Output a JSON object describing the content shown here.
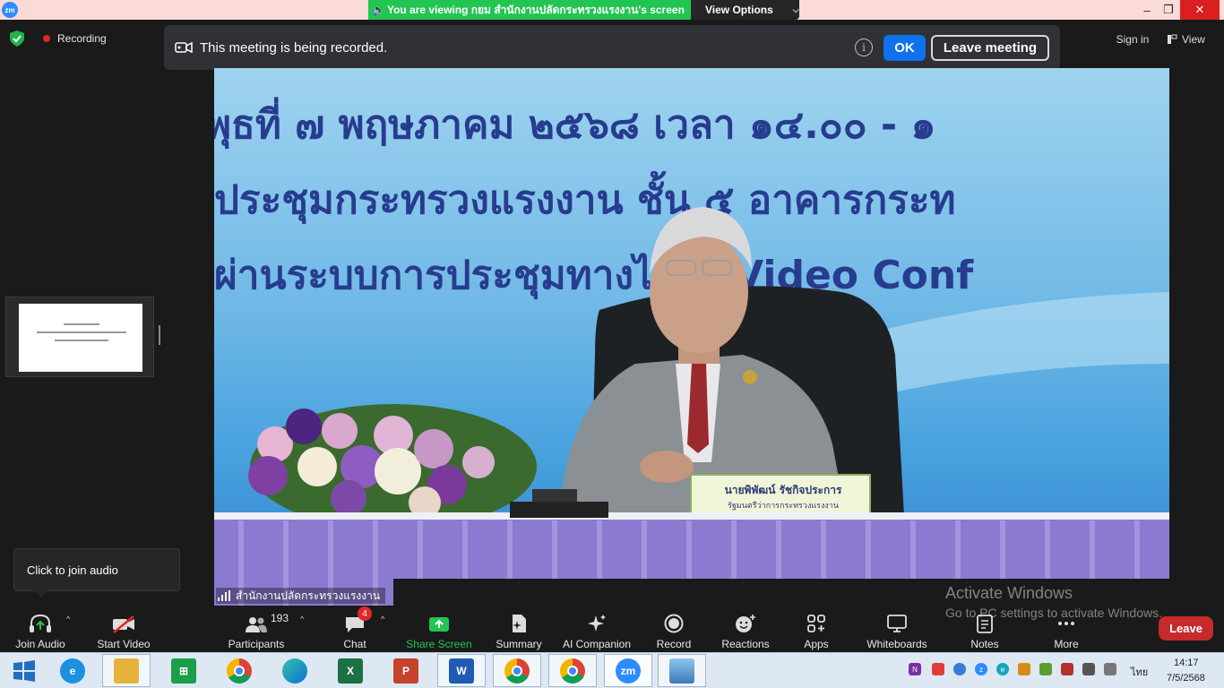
{
  "titlebar": {
    "logo": "zm",
    "share_banner": "You are viewing กยม สำนักงานปลัดกระทรวงแรงงาน's screen",
    "view_options": "View Options",
    "minimize": "–",
    "maximize": "❐",
    "close": "✕"
  },
  "recording": {
    "label": "Recording",
    "notice": "This meeting is being recorded.",
    "info": "i",
    "ok": "OK",
    "leave_meeting": "Leave meeting"
  },
  "top_right": {
    "sign_in": "Sign in",
    "view": "View"
  },
  "video": {
    "banner_line1": "พุธที่ ๗ พฤษภาคม ๒๕๖๘ เวลา ๑๔.๐๐ - ๑",
    "banner_line2": "ประชุมกระทรวงแรงงาน ชั้น ๕ อาคารกระท",
    "banner_line3": "ผ่านระบบการประชุมทางไกล (Video Conf",
    "nameplate_name": "นายพิพัฒน์ รัชกิจประการ",
    "nameplate_title": "รัฐมนตรีว่าการกระทรวงแรงงาน",
    "speaker_label": "สำนักงานปลัดกระทรวงแรงงาน"
  },
  "join_tooltip": "Click to join audio",
  "activate": {
    "line1": "Activate Windows",
    "line2": "Go to PC settings to activate Windows."
  },
  "toolbar": {
    "join_audio": "Join Audio",
    "start_video": "Start Video",
    "participants": "Participants",
    "participants_count": "193",
    "chat": "Chat",
    "chat_badge": "4",
    "share_screen": "Share Screen",
    "summary": "Summary",
    "ai_companion": "AI Companion",
    "record": "Record",
    "reactions": "Reactions",
    "apps": "Apps",
    "whiteboards": "Whiteboards",
    "notes": "Notes",
    "more": "More",
    "leave": "Leave",
    "caret": "^"
  },
  "taskbar": {
    "language": "ไทย",
    "time": "14:17",
    "date": "7/5/2568"
  },
  "colors": {
    "share_green": "#23c552",
    "ok_blue": "#0e72ed",
    "leave_red": "#c62a2a",
    "banner_text": "#273c8f"
  }
}
